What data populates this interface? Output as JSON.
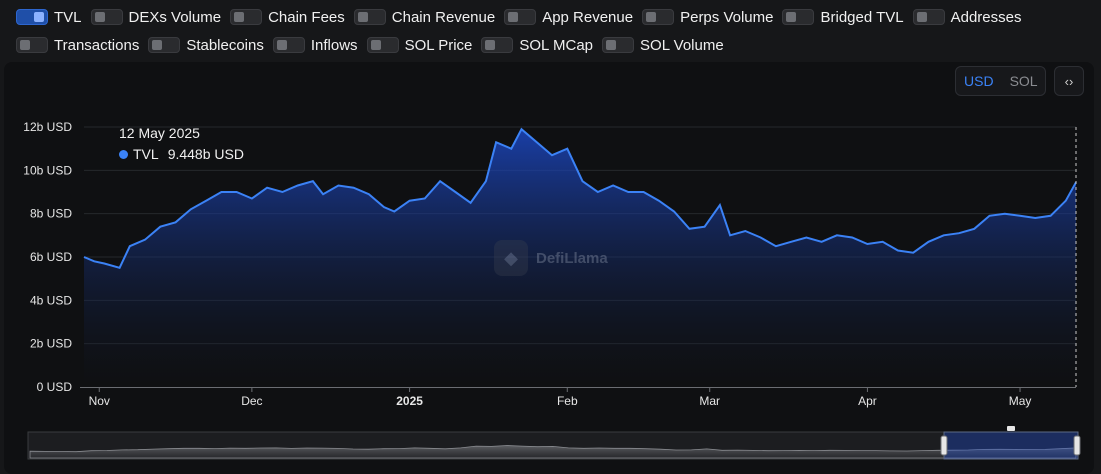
{
  "toggles": [
    {
      "label": "TVL",
      "on": true
    },
    {
      "label": "DEXs Volume",
      "on": false
    },
    {
      "label": "Chain Fees",
      "on": false
    },
    {
      "label": "Chain Revenue",
      "on": false
    },
    {
      "label": "App Revenue",
      "on": false
    },
    {
      "label": "Perps Volume",
      "on": false
    },
    {
      "label": "Bridged TVL",
      "on": false
    },
    {
      "label": "Addresses",
      "on": false
    },
    {
      "label": "Transactions",
      "on": false
    },
    {
      "label": "Stablecoins",
      "on": false
    },
    {
      "label": "Inflows",
      "on": false
    },
    {
      "label": "SOL Price",
      "on": false
    },
    {
      "label": "SOL MCap",
      "on": false
    },
    {
      "label": "SOL Volume",
      "on": false
    }
  ],
  "unit_toggle": {
    "usd": "USD",
    "sol": "SOL",
    "selected": "USD"
  },
  "embed_label": "‹›",
  "tooltip": {
    "date": "12 May 2025",
    "series": "TVL",
    "value": "9.448b USD"
  },
  "watermark": "DefiLlama",
  "colors": {
    "line": "#3b82f6",
    "fill_top": "#1d4ed8",
    "fill_bottom": "#0f1012",
    "accent": "#3b82f6"
  },
  "chart_data": {
    "type": "area",
    "series_name": "TVL",
    "unit": "USD",
    "ylim": [
      0,
      12
    ],
    "yticks": [
      0,
      2,
      4,
      6,
      8,
      10,
      12
    ],
    "ytick_labels": [
      "0 USD",
      "2b USD",
      "4b USD",
      "6b USD",
      "8b USD",
      "10b USD",
      "12b USD"
    ],
    "xlim": [
      "2024-10-29",
      "2025-05-12"
    ],
    "xticks": [
      {
        "date": "2024-11-01",
        "label": "Nov",
        "bold": false
      },
      {
        "date": "2024-12-01",
        "label": "Dec",
        "bold": false
      },
      {
        "date": "2025-01-01",
        "label": "2025",
        "bold": true
      },
      {
        "date": "2025-02-01",
        "label": "Feb",
        "bold": false
      },
      {
        "date": "2025-03-01",
        "label": "Mar",
        "bold": false
      },
      {
        "date": "2025-04-01",
        "label": "Apr",
        "bold": false
      },
      {
        "date": "2025-05-01",
        "label": "May",
        "bold": false
      }
    ],
    "points": [
      [
        "2024-10-29",
        6.0
      ],
      [
        "2024-10-31",
        5.8
      ],
      [
        "2024-11-02",
        5.7
      ],
      [
        "2024-11-05",
        5.5
      ],
      [
        "2024-11-07",
        6.5
      ],
      [
        "2024-11-10",
        6.8
      ],
      [
        "2024-11-13",
        7.4
      ],
      [
        "2024-11-16",
        7.6
      ],
      [
        "2024-11-19",
        8.2
      ],
      [
        "2024-11-22",
        8.6
      ],
      [
        "2024-11-25",
        9.0
      ],
      [
        "2024-11-28",
        9.0
      ],
      [
        "2024-12-01",
        8.7
      ],
      [
        "2024-12-04",
        9.2
      ],
      [
        "2024-12-07",
        9.0
      ],
      [
        "2024-12-10",
        9.3
      ],
      [
        "2024-12-13",
        9.5
      ],
      [
        "2024-12-15",
        8.9
      ],
      [
        "2024-12-18",
        9.3
      ],
      [
        "2024-12-21",
        9.2
      ],
      [
        "2024-12-24",
        8.9
      ],
      [
        "2024-12-27",
        8.3
      ],
      [
        "2024-12-29",
        8.1
      ],
      [
        "2025-01-01",
        8.6
      ],
      [
        "2025-01-04",
        8.7
      ],
      [
        "2025-01-07",
        9.5
      ],
      [
        "2025-01-10",
        9.0
      ],
      [
        "2025-01-13",
        8.5
      ],
      [
        "2025-01-16",
        9.5
      ],
      [
        "2025-01-18",
        11.3
      ],
      [
        "2025-01-21",
        11.0
      ],
      [
        "2025-01-23",
        11.9
      ],
      [
        "2025-01-26",
        11.3
      ],
      [
        "2025-01-29",
        10.7
      ],
      [
        "2025-02-01",
        11.0
      ],
      [
        "2025-02-04",
        9.5
      ],
      [
        "2025-02-07",
        9.0
      ],
      [
        "2025-02-10",
        9.3
      ],
      [
        "2025-02-13",
        9.0
      ],
      [
        "2025-02-16",
        9.0
      ],
      [
        "2025-02-19",
        8.6
      ],
      [
        "2025-02-22",
        8.1
      ],
      [
        "2025-02-25",
        7.3
      ],
      [
        "2025-02-28",
        7.4
      ],
      [
        "2025-03-03",
        8.4
      ],
      [
        "2025-03-05",
        7.0
      ],
      [
        "2025-03-08",
        7.2
      ],
      [
        "2025-03-11",
        6.9
      ],
      [
        "2025-03-14",
        6.5
      ],
      [
        "2025-03-17",
        6.7
      ],
      [
        "2025-03-20",
        6.9
      ],
      [
        "2025-03-23",
        6.7
      ],
      [
        "2025-03-26",
        7.0
      ],
      [
        "2025-03-29",
        6.9
      ],
      [
        "2025-04-01",
        6.6
      ],
      [
        "2025-04-04",
        6.7
      ],
      [
        "2025-04-07",
        6.3
      ],
      [
        "2025-04-10",
        6.2
      ],
      [
        "2025-04-13",
        6.7
      ],
      [
        "2025-04-16",
        7.0
      ],
      [
        "2025-04-19",
        7.1
      ],
      [
        "2025-04-22",
        7.3
      ],
      [
        "2025-04-25",
        7.9
      ],
      [
        "2025-04-28",
        8.0
      ],
      [
        "2025-05-01",
        7.9
      ],
      [
        "2025-05-04",
        7.8
      ],
      [
        "2025-05-07",
        7.9
      ],
      [
        "2025-05-10",
        8.6
      ],
      [
        "2025-05-12",
        9.448
      ]
    ]
  }
}
